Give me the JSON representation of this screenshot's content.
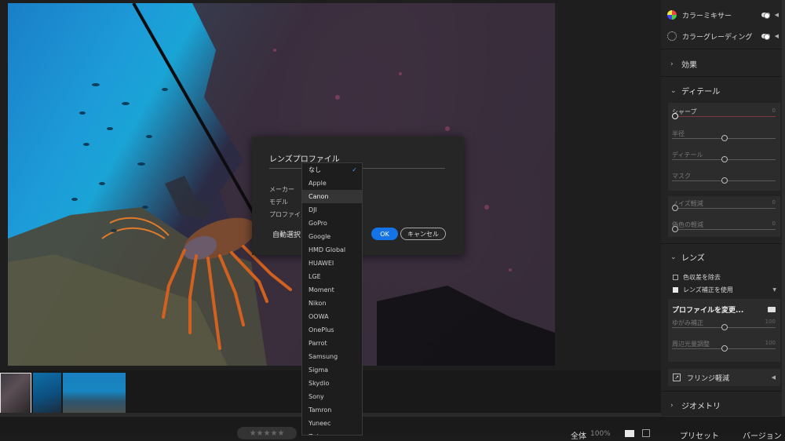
{
  "right_panel": {
    "color_mixer": {
      "label": "カラーミキサー"
    },
    "color_grading": {
      "label": "カラーグレーディング"
    },
    "effects": {
      "label": "効果"
    },
    "detail": {
      "label": "ディテール",
      "sharpen": {
        "label": "シャープ",
        "value": "0"
      },
      "radius": {
        "label": "半径"
      },
      "detail": {
        "label": "ディテール"
      },
      "mask": {
        "label": "マスク"
      },
      "noise_reduction": {
        "label": "ノイズ軽減",
        "value": "0"
      },
      "color_noise": {
        "label": "偽色の軽減",
        "value": "0"
      }
    },
    "lens": {
      "label": "レンズ",
      "remove_ca": {
        "label": "色収差を除去",
        "checked": false
      },
      "enable_correction": {
        "label": "レンズ補正を使用",
        "checked": true
      },
      "change_profile": {
        "label": "プロファイルを変更..."
      },
      "distortion": {
        "label": "ゆがみ補正",
        "value": "100"
      },
      "vignetting": {
        "label": "周辺光量調整",
        "value": "100"
      }
    },
    "defringe": {
      "label": "フリンジ軽減"
    },
    "geometry": {
      "label": "ジオメトリ"
    }
  },
  "dialog": {
    "title": "レンズプロファイル",
    "maker_label": "メーカー",
    "model_label": "モデル",
    "profile_label": "プロファイル",
    "auto_select": "自動選択",
    "ok_label": "OK",
    "cancel_label": "キャンセル"
  },
  "dropdown": {
    "items": [
      "なし",
      "Apple",
      "Canon",
      "DJI",
      "GoPro",
      "Google",
      "HMD Global",
      "HUAWEI",
      "LGE",
      "Moment",
      "Nikon",
      "OOWA",
      "OnePlus",
      "Parrot",
      "Samsung",
      "Sigma",
      "Skydio",
      "Sony",
      "Tamron",
      "Yuneec",
      "Zeiss"
    ],
    "selected": "なし",
    "hovered": "Canon"
  },
  "toolbar": {
    "stars": "★★★★★",
    "view_all": "全体",
    "zoom": "100%",
    "preset": "プリセット",
    "version": "バージョン"
  },
  "colors": {
    "accent": "#1473e6",
    "check": "#4c9dff"
  }
}
